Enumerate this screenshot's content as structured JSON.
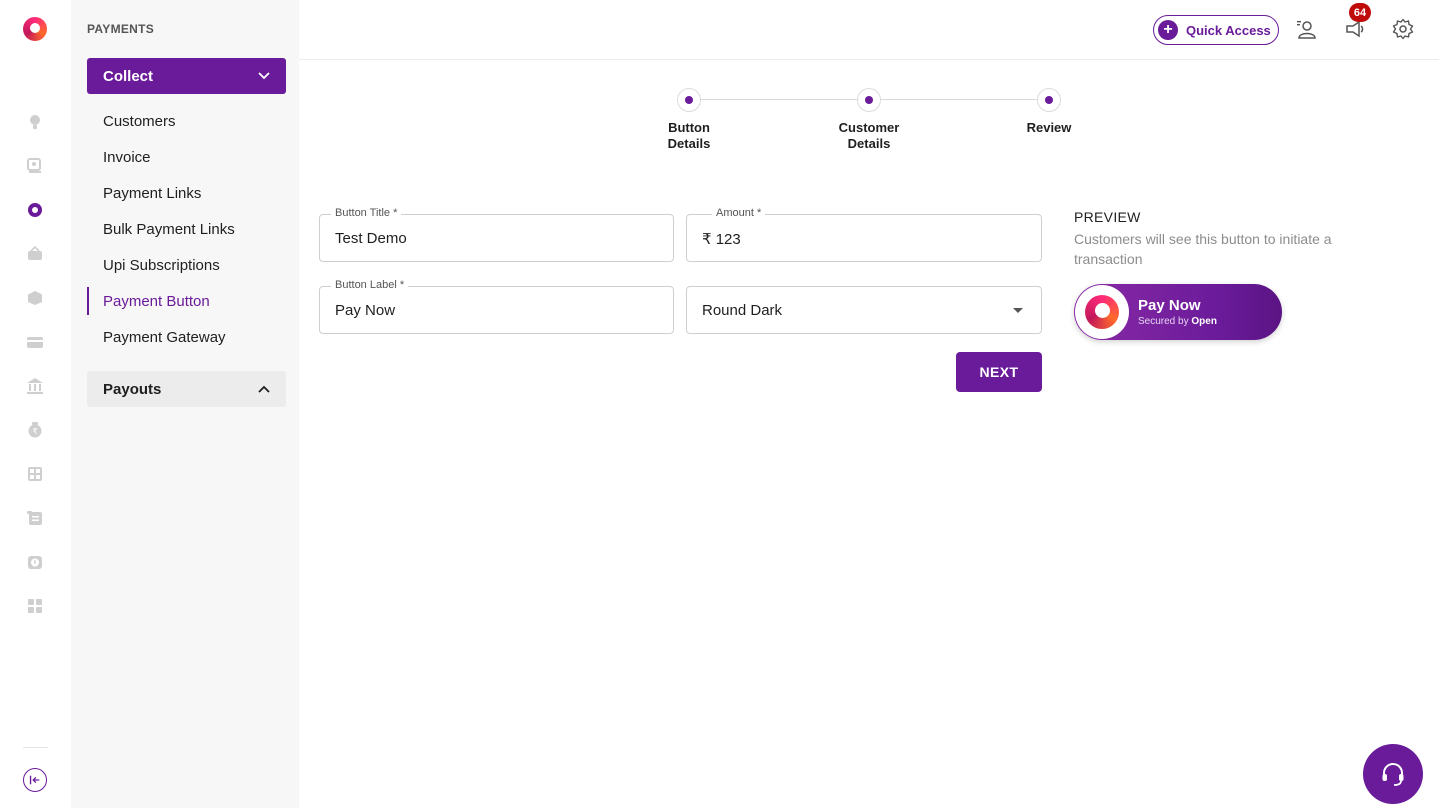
{
  "rail": {
    "icons": [
      "bulb-icon",
      "search-user-icon",
      "payments-icon",
      "basket-icon",
      "box-icon",
      "card-icon",
      "bank-icon",
      "rupee-bag-icon",
      "calculator-icon",
      "ledger-icon",
      "clock-rupee-icon",
      "grid-icon"
    ],
    "collapse_icon": "collapse-left-icon"
  },
  "sidebar": {
    "section_title": "PAYMENTS",
    "collect_label": "Collect",
    "items": [
      "Customers",
      "Invoice",
      "Payment Links",
      "Bulk Payment Links",
      "Upi Subscriptions",
      "Payment Button",
      "Payment Gateway"
    ],
    "active_item": "Payment Button",
    "payouts_label": "Payouts"
  },
  "topbar": {
    "quick_access_label": "Quick Access",
    "notification_count": "64"
  },
  "stepper": {
    "steps": [
      {
        "line1": "Button",
        "line2": "Details"
      },
      {
        "line1": "Customer",
        "line2": "Details"
      },
      {
        "line1": "Review",
        "line2": ""
      }
    ]
  },
  "form": {
    "button_title_label": "Button Title *",
    "button_title_value": "Test Demo",
    "amount_label": "Amount *",
    "amount_value": "₹ 123",
    "button_label_label": "Button Label *",
    "button_label_value": "Pay Now",
    "theme_value": "Round Dark",
    "next_label": "NEXT"
  },
  "preview": {
    "title": "PREVIEW",
    "description": "Customers will see this button to initiate a transaction",
    "pay_label": "Pay Now",
    "secured_text": "Secured by",
    "brand": "Open"
  },
  "colors": {
    "accent": "#6a1b9a",
    "badge": "#c00b0b"
  }
}
